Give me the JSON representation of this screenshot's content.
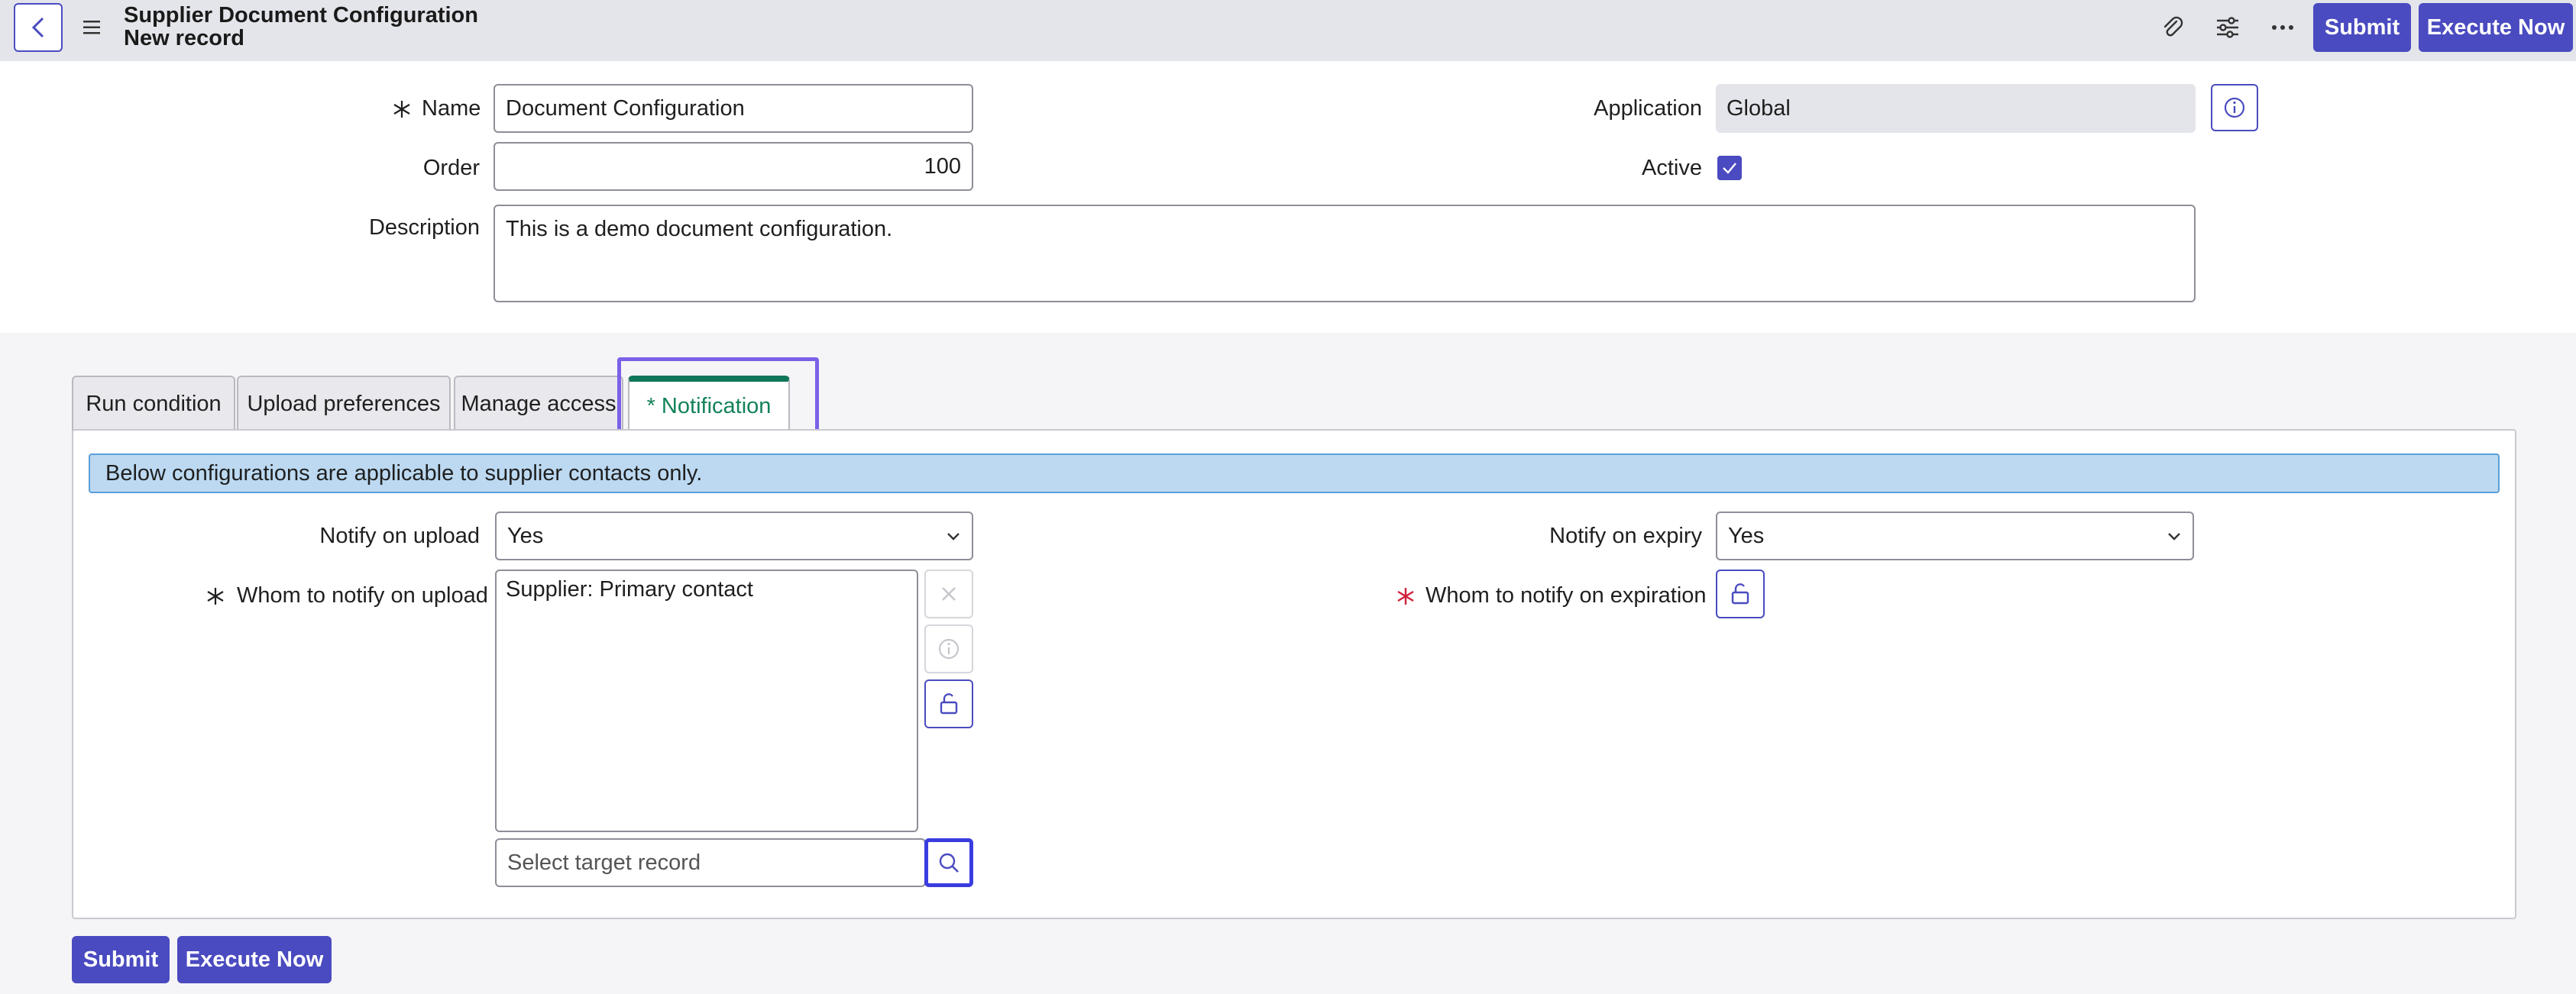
{
  "header": {
    "title": "Supplier Document Configuration",
    "subtitle": "New record",
    "submit_label": "Submit",
    "execute_label": "Execute Now",
    "icons": [
      "back-icon",
      "menu-icon",
      "paperclip-icon",
      "sliders-icon",
      "more-icon"
    ]
  },
  "form": {
    "name_label": "Name",
    "name_value": "Document Configuration",
    "order_label": "Order",
    "order_value": "100",
    "description_label": "Description",
    "description_value": "This is a demo document configuration.",
    "application_label": "Application",
    "application_value": "Global",
    "active_label": "Active",
    "active_checked": true,
    "required_mark": "∗"
  },
  "tabs": [
    {
      "label": "Run condition"
    },
    {
      "label": "Upload preferences"
    },
    {
      "label": "Manage access"
    },
    {
      "label": "* Notification",
      "active": true
    }
  ],
  "notification": {
    "info_text": "Below configurations are applicable to supplier contacts only.",
    "notify_upload_label": "Notify on upload",
    "notify_upload_value": "Yes",
    "whom_upload_label": "Whom to notify on upload",
    "whom_upload_items": [
      "Supplier: Primary contact"
    ],
    "select_target_placeholder": "Select target record",
    "notify_expiry_label": "Notify on expiry",
    "notify_expiry_value": "Yes",
    "whom_expiry_label": "Whom to notify on expiration"
  },
  "footer": {
    "submit_label": "Submit",
    "execute_label": "Execute Now"
  },
  "colors": {
    "primary": "#4a4bc0",
    "active_tab": "#148259",
    "highlight": "#7b61e8",
    "required_red": "#d0213a",
    "info_bg": "#bcd9f1"
  }
}
